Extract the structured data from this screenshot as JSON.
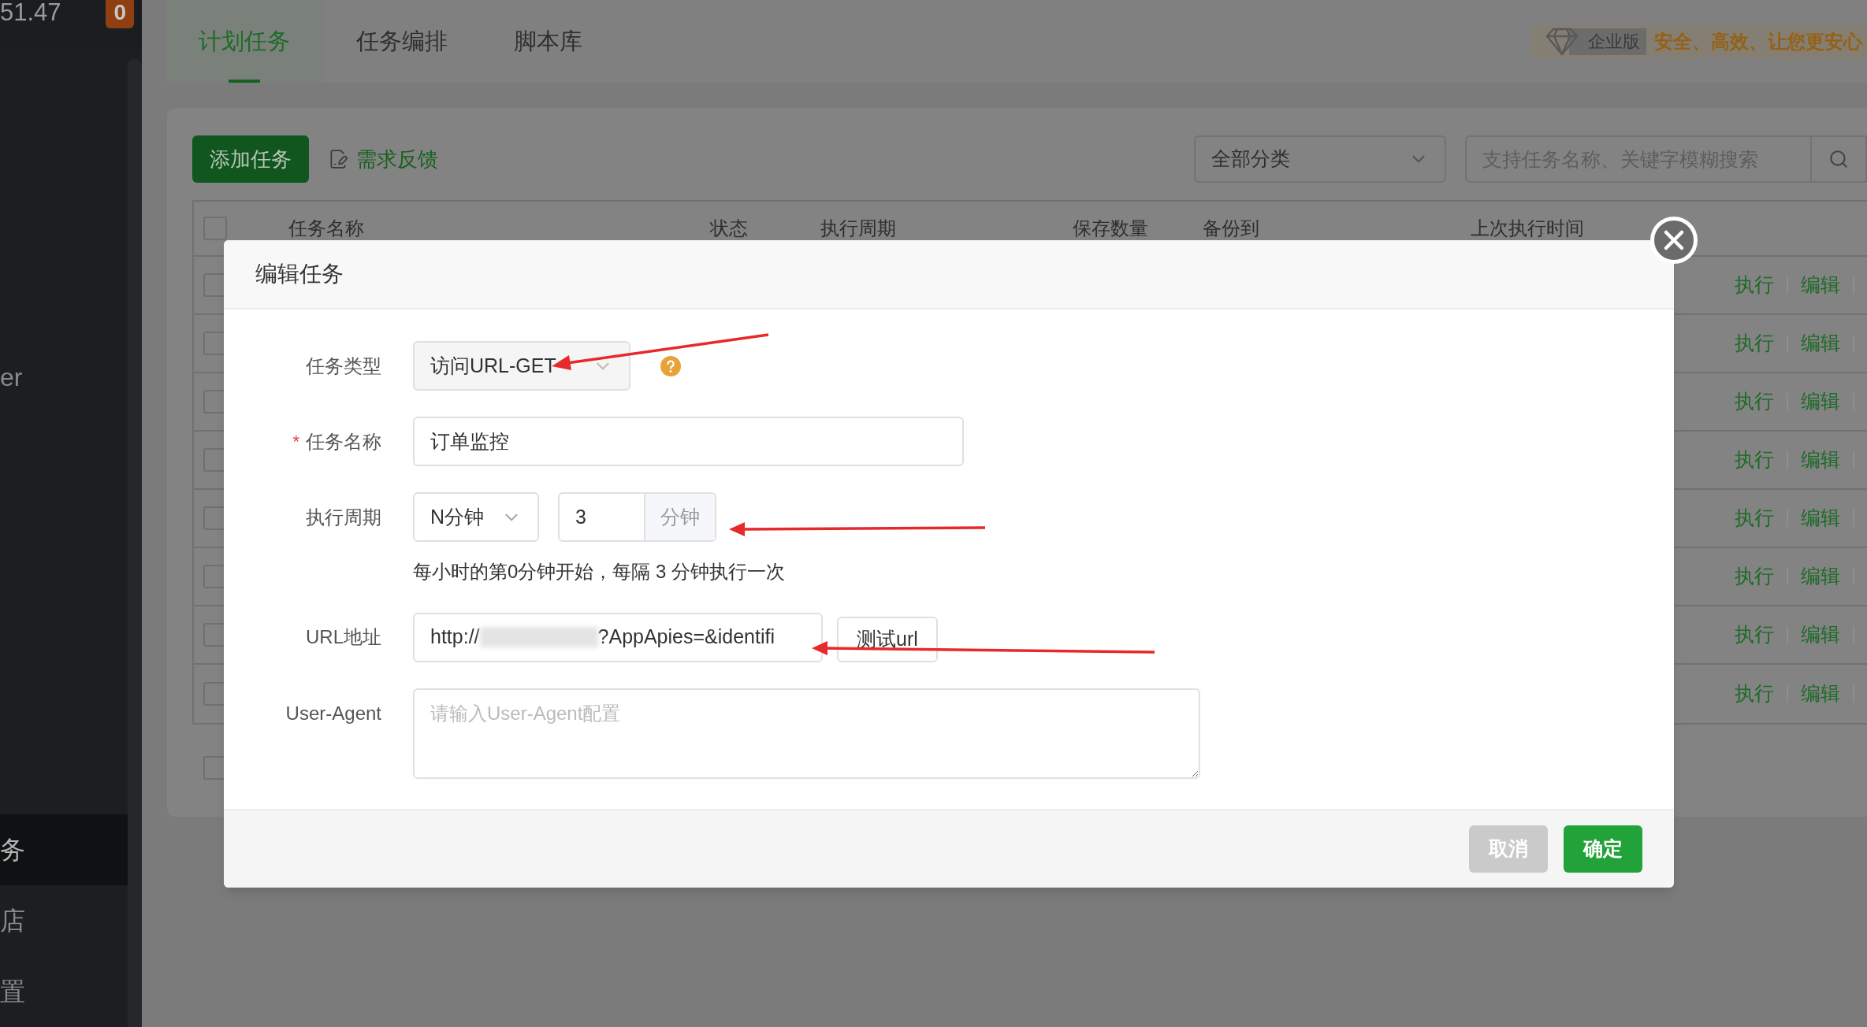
{
  "sidebar": {
    "host_text": "51.47",
    "badge": "0",
    "items": [
      {
        "label": "er",
        "selected": false
      },
      {
        "label": "务",
        "selected": true
      },
      {
        "label": "店",
        "selected": false
      },
      {
        "label": "置",
        "selected": false
      }
    ]
  },
  "tabs": [
    {
      "label": "计划任务",
      "selected": true
    },
    {
      "label": "任务编排",
      "selected": false
    },
    {
      "label": "脚本库",
      "selected": false
    }
  ],
  "edition": {
    "tag": "企业版",
    "slogan": "安全、高效、让您更安心"
  },
  "toolbar": {
    "add_button": "添加任务",
    "feedback_link": "需求反馈",
    "category_select": "全部分类",
    "search_placeholder": "支持任务名称、关键字模糊搜索"
  },
  "table": {
    "header_checked": false,
    "footer_checked": false,
    "columns": [
      "任务名称",
      "状态",
      "执行周期",
      "保存数量",
      "备份到",
      "上次执行时间"
    ],
    "rows": [
      {
        "checked": false,
        "actions": [
          "执行",
          "编辑"
        ]
      },
      {
        "checked": false,
        "actions": [
          "执行",
          "编辑"
        ]
      },
      {
        "checked": false,
        "actions": [
          "执行",
          "编辑"
        ]
      },
      {
        "checked": false,
        "actions": [
          "执行",
          "编辑"
        ]
      },
      {
        "checked": false,
        "actions": [
          "执行",
          "编辑"
        ]
      },
      {
        "checked": false,
        "actions": [
          "执行",
          "编辑"
        ]
      },
      {
        "checked": false,
        "actions": [
          "执行",
          "编辑"
        ]
      },
      {
        "checked": false,
        "actions": [
          "执行",
          "编辑"
        ]
      }
    ]
  },
  "dialog": {
    "title": "编辑任务",
    "task_type": {
      "label": "任务类型",
      "value": "访问URL-GET"
    },
    "task_name": {
      "label": "任务名称",
      "required_mark": "*",
      "value": "订单监控"
    },
    "period": {
      "label": "执行周期",
      "unit_select": "N分钟",
      "value": "3",
      "addon": "分钟",
      "hint": "每小时的第0分钟开始，每隔 3 分钟执行一次"
    },
    "url": {
      "label": "URL地址",
      "value_start": "http://",
      "value_end": "?AppApies=&identifi",
      "test_button": "测试url"
    },
    "user_agent": {
      "label": "User-Agent",
      "placeholder": "请输入User-Agent配置"
    },
    "buttons": [
      {
        "label": "取消",
        "kind": "secondary"
      },
      {
        "label": "确定",
        "kind": "primary"
      }
    ]
  }
}
